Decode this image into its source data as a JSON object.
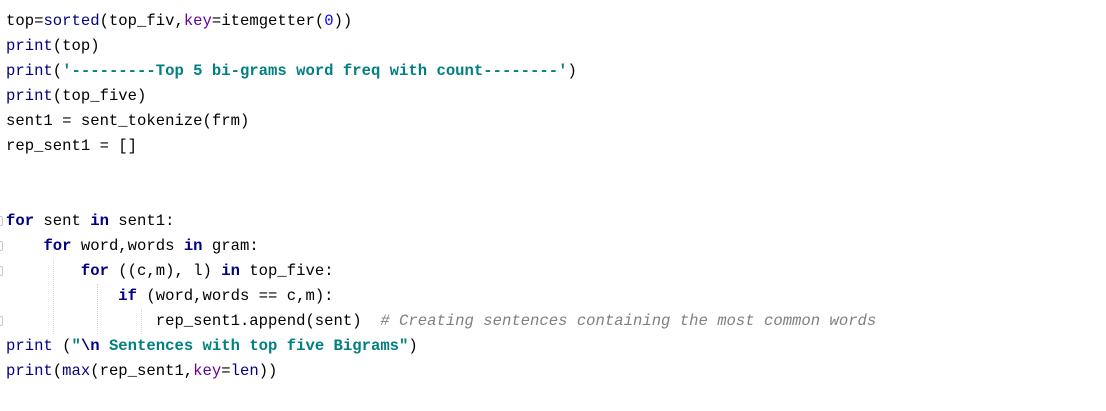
{
  "editor": {
    "lines": [
      {
        "id": "line-1",
        "tokens": [
          {
            "t": "plain",
            "v": "top="
          },
          {
            "t": "bi",
            "v": "sorted"
          },
          {
            "t": "plain",
            "v": "(top_fiv,"
          },
          {
            "t": "kwarg",
            "v": "key"
          },
          {
            "t": "plain",
            "v": "=itemgetter("
          },
          {
            "t": "num",
            "v": "0"
          },
          {
            "t": "plain",
            "v": "))"
          }
        ]
      },
      {
        "id": "line-2",
        "tokens": [
          {
            "t": "bi",
            "v": "print"
          },
          {
            "t": "plain",
            "v": "(top)"
          }
        ]
      },
      {
        "id": "line-3",
        "tokens": [
          {
            "t": "bi",
            "v": "print"
          },
          {
            "t": "plain",
            "v": "("
          },
          {
            "t": "str",
            "v": "'---------Top 5 bi-grams word freq with count--------'"
          },
          {
            "t": "plain",
            "v": ")"
          }
        ]
      },
      {
        "id": "line-4",
        "tokens": [
          {
            "t": "bi",
            "v": "print"
          },
          {
            "t": "plain",
            "v": "(top_five)"
          }
        ]
      },
      {
        "id": "line-5",
        "tokens": [
          {
            "t": "plain",
            "v": "sent1 = sent_tokenize(frm)"
          }
        ]
      },
      {
        "id": "line-6",
        "tokens": [
          {
            "t": "plain",
            "v": "rep_sent1 = []"
          }
        ]
      },
      {
        "id": "line-7",
        "tokens": []
      },
      {
        "id": "line-8",
        "tokens": []
      },
      {
        "id": "line-9",
        "tokens": [
          {
            "t": "kw",
            "v": "for"
          },
          {
            "t": "plain",
            "v": " sent "
          },
          {
            "t": "kw",
            "v": "in"
          },
          {
            "t": "plain",
            "v": " sent1:"
          }
        ]
      },
      {
        "id": "line-10",
        "tokens": [
          {
            "t": "plain",
            "v": "    "
          },
          {
            "t": "kw",
            "v": "for"
          },
          {
            "t": "plain",
            "v": " word,words "
          },
          {
            "t": "kw",
            "v": "in"
          },
          {
            "t": "plain",
            "v": " gram:"
          }
        ]
      },
      {
        "id": "line-11",
        "tokens": [
          {
            "t": "plain",
            "v": "        "
          },
          {
            "t": "kw",
            "v": "for"
          },
          {
            "t": "plain",
            "v": " ((c,m), l) "
          },
          {
            "t": "kw",
            "v": "in"
          },
          {
            "t": "plain",
            "v": " top_five:"
          }
        ]
      },
      {
        "id": "line-12",
        "tokens": [
          {
            "t": "plain",
            "v": "            "
          },
          {
            "t": "kw",
            "v": "if"
          },
          {
            "t": "plain",
            "v": " (word,words == c,m):"
          }
        ]
      },
      {
        "id": "line-13",
        "tokens": [
          {
            "t": "plain",
            "v": "                rep_sent1.append(sent)  "
          },
          {
            "t": "cmt",
            "v": "# Creating sentences containing the most common words"
          }
        ]
      },
      {
        "id": "line-14",
        "tokens": [
          {
            "t": "bi",
            "v": "print"
          },
          {
            "t": "plain",
            "v": " ("
          },
          {
            "t": "str",
            "v": "\""
          },
          {
            "t": "esc",
            "v": "\\n"
          },
          {
            "t": "str",
            "v": " Sentences with top five Bigrams\""
          },
          {
            "t": "plain",
            "v": ")"
          }
        ]
      },
      {
        "id": "line-15",
        "tokens": [
          {
            "t": "bi",
            "v": "print"
          },
          {
            "t": "plain",
            "v": "("
          },
          {
            "t": "bi",
            "v": "max"
          },
          {
            "t": "plain",
            "v": "(rep_sent1,"
          },
          {
            "t": "kwarg",
            "v": "key"
          },
          {
            "t": "plain",
            "v": "="
          },
          {
            "t": "bi",
            "v": "len"
          },
          {
            "t": "plain",
            "v": "))"
          }
        ]
      }
    ],
    "colors": {
      "keyword": "#000080",
      "builtin": "#000080",
      "string": "#008080",
      "number": "#0000ff",
      "comment": "#808080",
      "kwarg": "#660099",
      "plain": "#000000",
      "background": "#ffffff"
    }
  }
}
